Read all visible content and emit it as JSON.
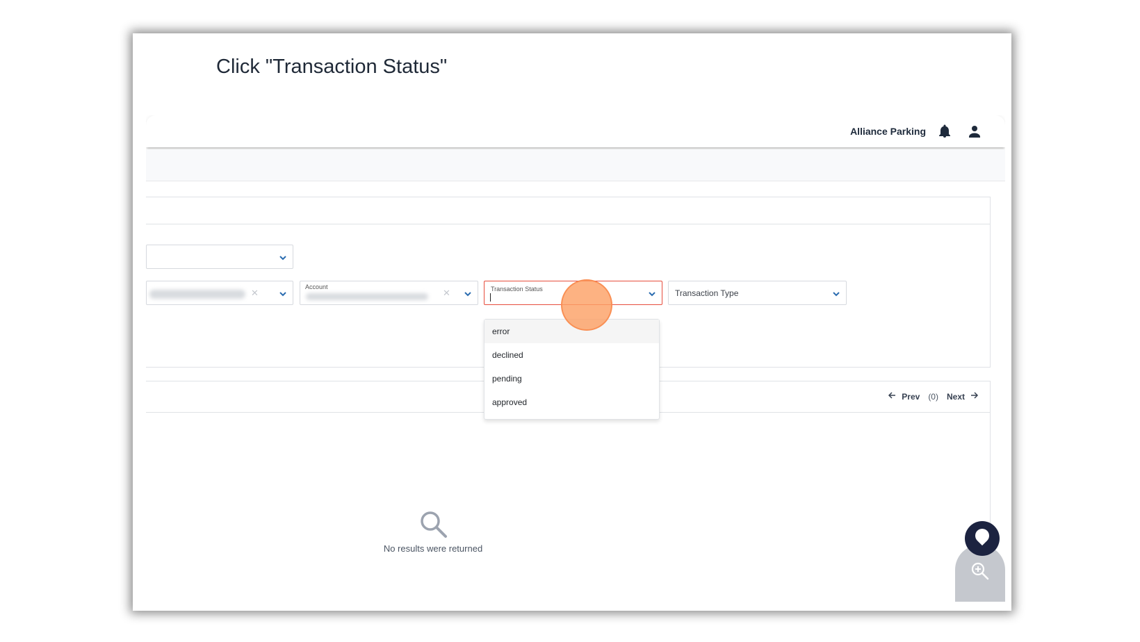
{
  "instruction": "Click \"Transaction Status\"",
  "header": {
    "org_name": "Alliance Parking"
  },
  "filters": {
    "account_label": "Account",
    "transaction_status_label": "Transaction Status",
    "transaction_type_placeholder": "Transaction Type"
  },
  "status_dropdown": {
    "options": [
      "error",
      "declined",
      "pending",
      "approved"
    ]
  },
  "pagination": {
    "prev_label": "Prev",
    "count": "(0)",
    "next_label": "Next"
  },
  "results": {
    "empty_message": "No results were returned"
  },
  "colors": {
    "accent_blue": "#2b6cb0",
    "active_border": "#e74c3c",
    "click_marker": "#fda167",
    "nav_dark": "#1c2340"
  },
  "icons": [
    "bell-icon",
    "user-icon",
    "chevron-down-icon",
    "clear-icon",
    "arrow-left-icon",
    "arrow-right-icon",
    "search-icon",
    "zoom-in-icon",
    "zoom-out-icon",
    "pin-icon",
    "drag-handle-icon"
  ]
}
